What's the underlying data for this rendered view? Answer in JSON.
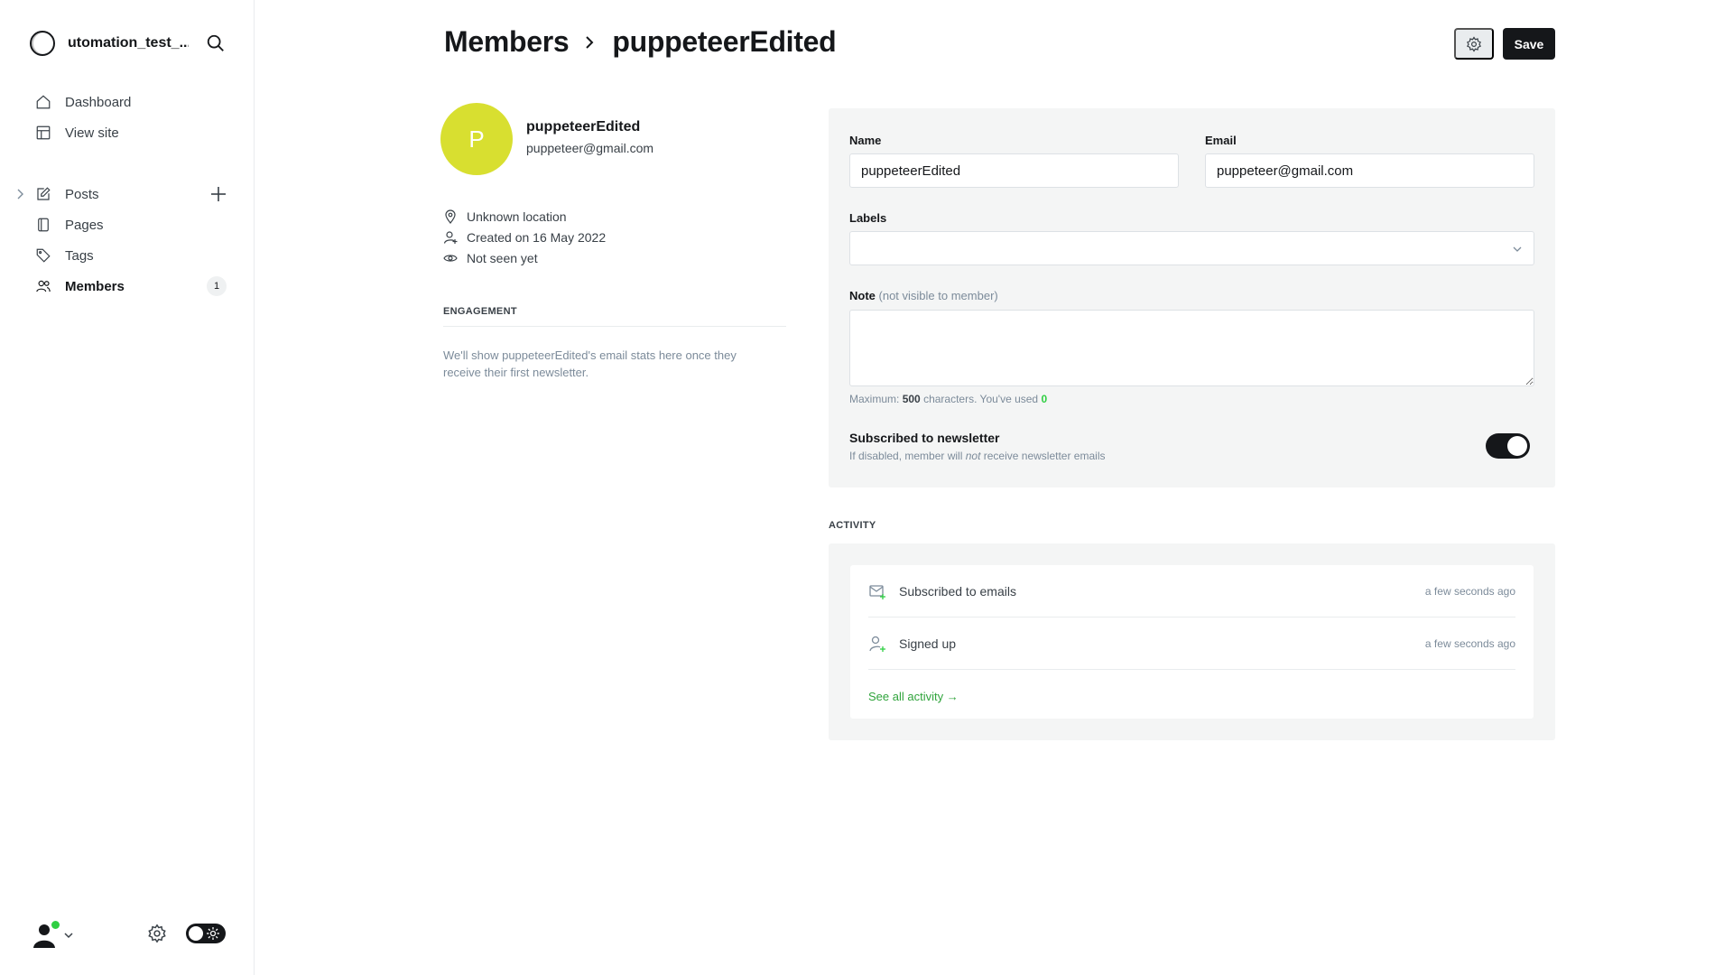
{
  "sidebar": {
    "site_name": "utomation_test_...",
    "nav_primary": [
      {
        "label": "Dashboard",
        "icon": "home-icon"
      },
      {
        "label": "View site",
        "icon": "layout-icon"
      }
    ],
    "nav_content": [
      {
        "label": "Posts",
        "icon": "edit-icon"
      },
      {
        "label": "Pages",
        "icon": "pages-icon"
      },
      {
        "label": "Tags",
        "icon": "tag-icon"
      },
      {
        "label": "Members",
        "icon": "members-icon",
        "count": "1",
        "active": true
      }
    ]
  },
  "header": {
    "breadcrumb_parent": "Members",
    "breadcrumb_current": "puppeteerEdited",
    "save_label": "Save"
  },
  "member": {
    "avatar_initial": "P",
    "avatar_color": "#d8df30",
    "name": "puppeteerEdited",
    "email": "puppeteer@gmail.com",
    "location": "Unknown location",
    "created": "Created on 16 May 2022",
    "last_seen": "Not seen yet"
  },
  "engagement": {
    "title": "ENGAGEMENT",
    "text": "We'll show puppeteerEdited's email stats here once they receive their first newsletter."
  },
  "form": {
    "name_label": "Name",
    "name_value": "puppeteerEdited",
    "email_label": "Email",
    "email_value": "puppeteer@gmail.com",
    "labels_label": "Labels",
    "note_label": "Note",
    "note_sub": "(not visible to member)",
    "note_hint_prefix": "Maximum:",
    "note_hint_max": "500",
    "note_hint_mid": "characters. You've used",
    "note_hint_used": "0",
    "newsletter_title": "Subscribed to newsletter",
    "newsletter_desc_a": "If disabled, member will",
    "newsletter_desc_em": "not",
    "newsletter_desc_b": "receive newsletter emails",
    "newsletter_enabled": true
  },
  "activity": {
    "title": "ACTIVITY",
    "items": [
      {
        "label": "Subscribed to emails",
        "time": "a few seconds ago",
        "icon": "email-plus-icon"
      },
      {
        "label": "Signed up",
        "time": "a few seconds ago",
        "icon": "user-plus-icon"
      }
    ],
    "see_all": "See all activity →"
  },
  "colors": {
    "accent_green": "#30cf43",
    "primary_dark": "#15171a"
  }
}
